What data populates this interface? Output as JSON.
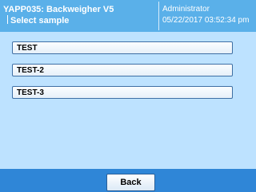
{
  "header": {
    "app_title": "YAPP035: Backweigher V5",
    "screen_title": "Select sample",
    "user": "Administrator",
    "datetime": "05/22/2017 03:52:34 pm"
  },
  "samples": [
    {
      "label": "TEST"
    },
    {
      "label": "TEST-2"
    },
    {
      "label": "TEST-3"
    }
  ],
  "footer": {
    "back_label": "Back"
  },
  "colors": {
    "header_bg": "#5ab0e9",
    "content_bg": "#bde2ff",
    "footer_bg": "#2f86d7"
  }
}
